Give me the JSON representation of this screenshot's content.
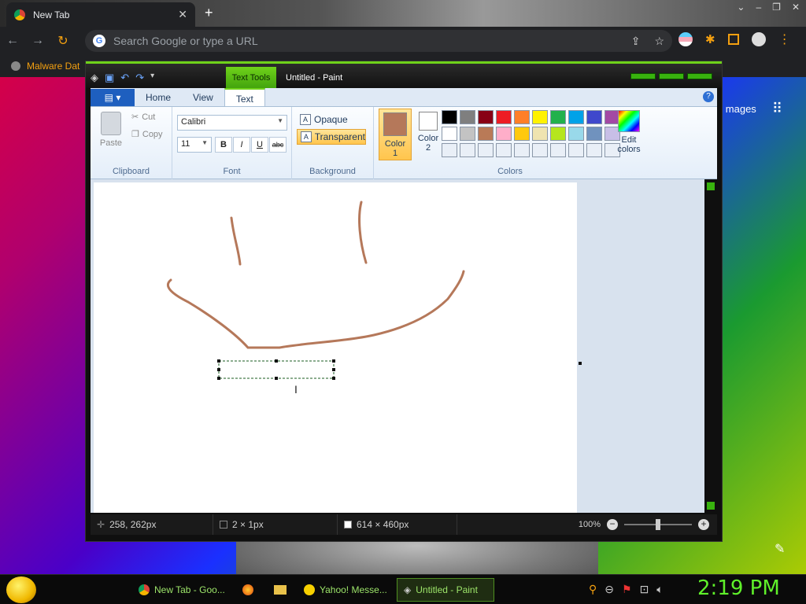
{
  "browser": {
    "tab_title": "New Tab",
    "omnibox_placeholder": "Search Google or type a URL",
    "bookmark_label": "Malware Dat",
    "images_link": "mages"
  },
  "paint": {
    "contextual_tab": "Text Tools",
    "window_title": "Untitled - Paint",
    "ribbon_tabs": {
      "home": "Home",
      "view": "View",
      "text": "Text"
    },
    "clipboard": {
      "paste": "Paste",
      "cut": "Cut",
      "copy": "Copy",
      "label": "Clipboard"
    },
    "font": {
      "family": "Calibri",
      "size": "11",
      "bold": "B",
      "italic": "I",
      "underline": "U",
      "strike": "abc",
      "label": "Font"
    },
    "background": {
      "opaque": "Opaque",
      "transparent": "Transparent",
      "label": "Background"
    },
    "colors": {
      "color1_label": "Color",
      "color1_num": "1",
      "color2_label": "Color",
      "color2_num": "2",
      "edit_label": "Edit",
      "edit_label2": "colors",
      "label": "Colors",
      "color1": "#b5785a",
      "color2": "#ffffff",
      "palette": [
        "#000000",
        "#7f7f7f",
        "#880015",
        "#ed1c24",
        "#ff7f27",
        "#fff200",
        "#22b14c",
        "#00a2e8",
        "#3f48cc",
        "#a349a4",
        "#ffffff",
        "#c3c3c3",
        "#b97a57",
        "#ffaec9",
        "#ffc90e",
        "#efe4b0",
        "#b5e61d",
        "#99d9ea",
        "#7092be",
        "#c8bfe7",
        "",
        "",
        "",
        "",
        "",
        "",
        "",
        "",
        "",
        ""
      ]
    },
    "status": {
      "cursor_pos": "258, 262px",
      "selection_size": "2 × 1px",
      "canvas_size": "614 × 460px",
      "zoom": "100%"
    },
    "stroke_color": "#b5785a"
  },
  "taskbar": {
    "tasks": [
      {
        "label": "New Tab - Goo..."
      },
      {
        "label": "Yahoo! Messe..."
      },
      {
        "label": "Untitled - Paint"
      }
    ],
    "clock": "2:19 PM"
  }
}
